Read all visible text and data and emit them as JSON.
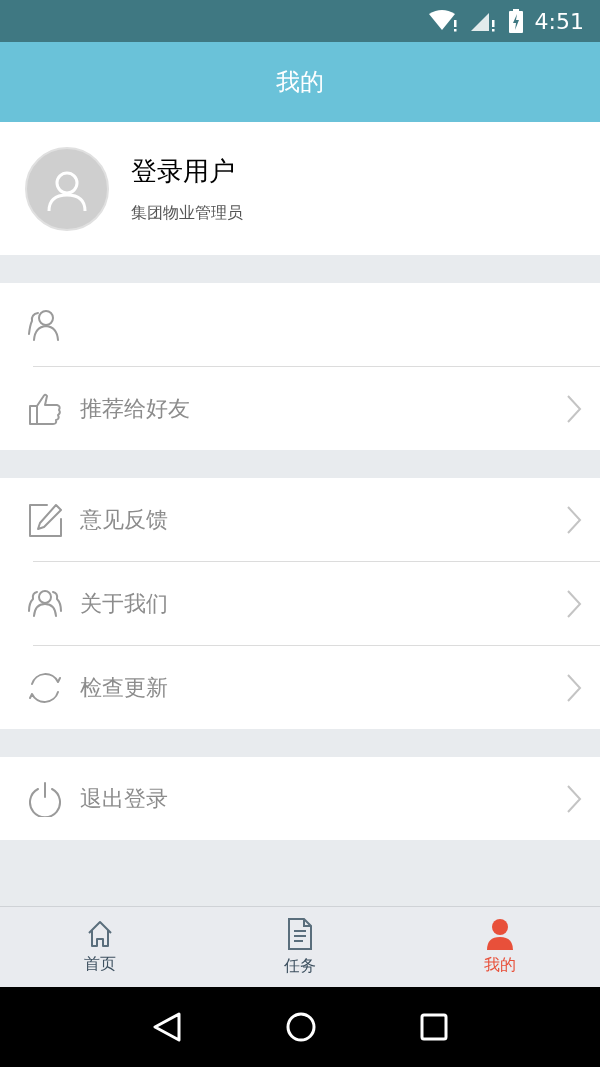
{
  "status_bar": {
    "time": "4:51"
  },
  "header": {
    "title": "我的"
  },
  "profile": {
    "name": "登录用户",
    "role": "集团物业管理员"
  },
  "groups": [
    {
      "items": [
        {
          "kind": "person",
          "chevron": false
        },
        {
          "kind": "thumb",
          "label": "推荐给好友",
          "chevron": true
        }
      ]
    },
    {
      "items": [
        {
          "kind": "edit",
          "label": "意见反馈",
          "chevron": true
        },
        {
          "kind": "group",
          "label": "关于我们",
          "chevron": true
        },
        {
          "kind": "refresh",
          "label": "检查更新",
          "chevron": true
        }
      ]
    },
    {
      "items": [
        {
          "kind": "power",
          "label": "退出登录",
          "chevron": true
        }
      ]
    }
  ],
  "tabs": [
    {
      "kind": "home",
      "label": "首页",
      "selected": false
    },
    {
      "kind": "doc",
      "label": "任务",
      "selected": false
    },
    {
      "kind": "user",
      "label": "我的",
      "selected": true
    }
  ]
}
